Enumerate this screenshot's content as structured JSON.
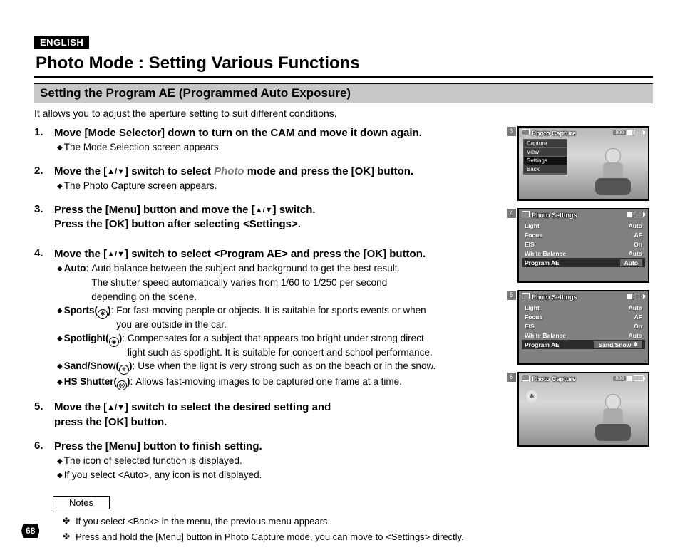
{
  "language_badge": "ENGLISH",
  "title": "Photo Mode : Setting Various Functions",
  "subtitle": "Setting the Program AE (Programmed Auto Exposure)",
  "intro": "It allows you to adjust the aperture setting to suit different conditions.",
  "steps": {
    "s1": {
      "main": "Move [Mode Selector] down to turn on the CAM and move it down again.",
      "sub1": "The Mode Selection screen appears."
    },
    "s2": {
      "main_a": "Move the [",
      "main_b": "] switch to select ",
      "mode": "Photo",
      "main_c": " mode and press the [OK] button.",
      "sub1": "The Photo Capture screen appears."
    },
    "s3": {
      "line1_a": "Press the [Menu] button and move the [",
      "line1_b": "] switch.",
      "line2": "Press the [OK] button after selecting <Settings>."
    },
    "s4": {
      "main_a": "Move the [",
      "main_b": "] switch to select <Program AE> and press the [OK] button.",
      "opts": {
        "auto": {
          "label": "Auto",
          "l1": "Auto balance between the subject and background to get the best result.",
          "l2": "The shutter speed automatically varies from 1/60 to 1/250 per second",
          "l3": "depending on the scene."
        },
        "sports": {
          "label": "Sports(",
          "l1": "For fast-moving people or objects. It is suitable for sports events or when",
          "l2": "you are outside in the car."
        },
        "spotlight": {
          "label": "Spotlight(",
          "l1": "Compensates for a subject that appears too bright under strong direct",
          "l2": "light such as spotlight. It is suitable for concert and school performance."
        },
        "sand": {
          "label": "Sand/Snow(",
          "l1": "Use when the light is very strong such as on the beach or in the snow."
        },
        "hs": {
          "label": "HS Shutter(",
          "l1": "Allows fast-moving images to be captured one frame at a time."
        }
      }
    },
    "s5": {
      "line1_a": "Move the [",
      "line1_b": "] switch to select the desired setting and",
      "line2": "press the [OK] button."
    },
    "s6": {
      "main": "Press the [Menu] button to finish setting.",
      "sub1": "The icon of selected function is displayed.",
      "sub2": "If you select <Auto>, any icon is not displayed."
    }
  },
  "notes_label": "Notes",
  "notes": {
    "n1": "If you select <Back> in the menu, the previous menu appears.",
    "n2": "Press and hold the [Menu] button in Photo Capture mode, you can move to <Settings> directly."
  },
  "page_number": "68",
  "screens": {
    "s3": {
      "num": "3",
      "header": "Photo Capture",
      "res": "800",
      "menu": [
        "Capture",
        "View",
        "Settings",
        "Back"
      ]
    },
    "s4": {
      "num": "4",
      "header": "Photo Settings",
      "rows": [
        {
          "k": "Light",
          "v": "Auto"
        },
        {
          "k": "Focus",
          "v": "AF"
        },
        {
          "k": "EIS",
          "v": "On"
        },
        {
          "k": "White Balance",
          "v": "Auto"
        }
      ],
      "hl": {
        "k": "Program AE",
        "v": "Auto"
      }
    },
    "s5": {
      "num": "5",
      "header": "Photo Settings",
      "rows": [
        {
          "k": "Light",
          "v": "Auto"
        },
        {
          "k": "Focus",
          "v": "AF"
        },
        {
          "k": "EIS",
          "v": "On"
        },
        {
          "k": "White Balance",
          "v": "Auto"
        }
      ],
      "hl": {
        "k": "Program AE",
        "v": "Sand/Snow"
      }
    },
    "s6": {
      "num": "6",
      "header": "Photo Capture",
      "res": "800"
    }
  }
}
